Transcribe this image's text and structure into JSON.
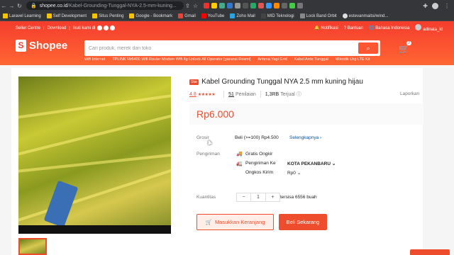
{
  "browser": {
    "url_host": "shopee.co.id",
    "url_path": "/Kabel-Grounding-Tunggal-NYA-2.5-mm-kuning...",
    "bookmarks": [
      "Laravel Learning",
      "Self Development",
      "Situs Penting",
      "Google - Bookmark",
      "Gmail",
      "YouTube",
      "Zoho Mail",
      "MID Teknologi",
      "Lock Band Orbit",
      "estevanmaitsi/wind..."
    ]
  },
  "topbar": {
    "seller_centre": "Seller Centre",
    "download": "Download",
    "follow": "Ikuti kami di",
    "notifications": "Notifikasi",
    "help": "Bantuan",
    "language": "Bahasa Indonesia",
    "username": "adinata_id"
  },
  "logo_text": "Shopee",
  "search": {
    "placeholder": "Cari produk, merek dan toko",
    "suggestions": [
      "Wifi Internet",
      "TPLINK Mr6400 Wifi Router Modem Wifi 4g Unlock All Operator [garansi Resmi]",
      "Antena Yagi Grid",
      "Kabel Arde Tunggal",
      "Mikrotik Lhg LTE Kit"
    ]
  },
  "cart": {
    "count": "2"
  },
  "product": {
    "badge": "Star",
    "title": "Kabel Grounding Tunggal NYA 2.5 mm kuning hijau",
    "rating": "4.8",
    "ratings_count": "51",
    "ratings_label": "Penilaian",
    "sold_count": "1,3RB",
    "sold_label": "Terjual",
    "report": "Laporkan",
    "price": "Rp6.000",
    "grosir_label": "Grosir",
    "grosir_value": "Beli (>=100) Rp4.500",
    "grosir_link": "Selengkapnya",
    "shipping_label": "Pengiriman",
    "free_shipping": "Gratis Ongkir",
    "ship_to_label": "Pengiriman Ke",
    "ship_to_value": "KOTA PEKANBARU",
    "ship_cost_label": "Ongkos Kirim",
    "ship_cost_value": "Rp0",
    "qty_label": "Kuantitas",
    "qty_value": "1",
    "stock": "tersisa 6556 buah",
    "add_to_cart": "Masukkan Keranjang",
    "buy_now": "Beli Sekarang"
  },
  "colors": {
    "brand": "#ee4d2d",
    "header": "#f53d2d"
  }
}
